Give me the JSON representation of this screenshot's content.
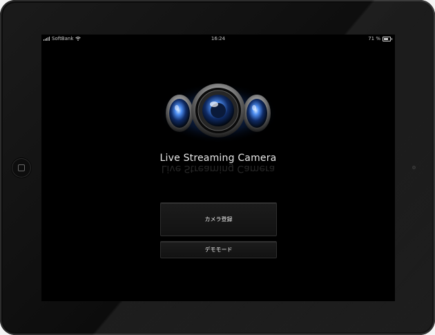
{
  "status_bar": {
    "carrier": "SoftBank",
    "time": "16:24",
    "battery_text": "71 %",
    "battery_level": 0.71,
    "signal_icon": "signal-icon",
    "wifi_icon": "wifi-icon",
    "battery_icon": "battery-icon"
  },
  "app": {
    "title": "Live Streaming Camera",
    "logo_icon": "camera-lenses-icon",
    "accent_color": "#2f6bd6"
  },
  "buttons": {
    "register_label": "カメラ登録",
    "demo_label": "デモモード"
  },
  "device": {
    "home_icon": "home-button-icon",
    "front_camera_icon": "front-camera-icon"
  }
}
